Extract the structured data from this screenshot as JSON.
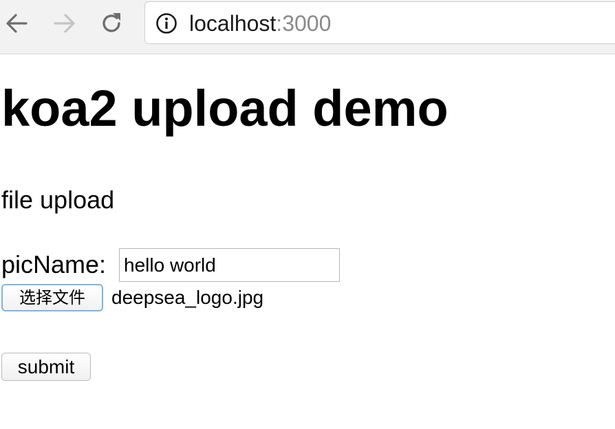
{
  "browser": {
    "back_icon": "arrow-left-icon",
    "forward_icon": "arrow-right-icon",
    "reload_icon": "reload-icon",
    "info_icon": "info-icon",
    "url_host": "localhost",
    "url_port": ":3000",
    "colors": {
      "toolbar_bg": "#f2f2f2",
      "icon_active": "#6e6e6e",
      "icon_disabled": "#c4c4c4",
      "port_text": "#8a8a8a"
    }
  },
  "page": {
    "title": "koa2 upload demo",
    "section_label": "file upload",
    "picname_label": "picName:",
    "picname_value": "hello world",
    "file_button_label": "选择文件",
    "file_name": "deepsea_logo.jpg",
    "submit_label": "submit"
  }
}
